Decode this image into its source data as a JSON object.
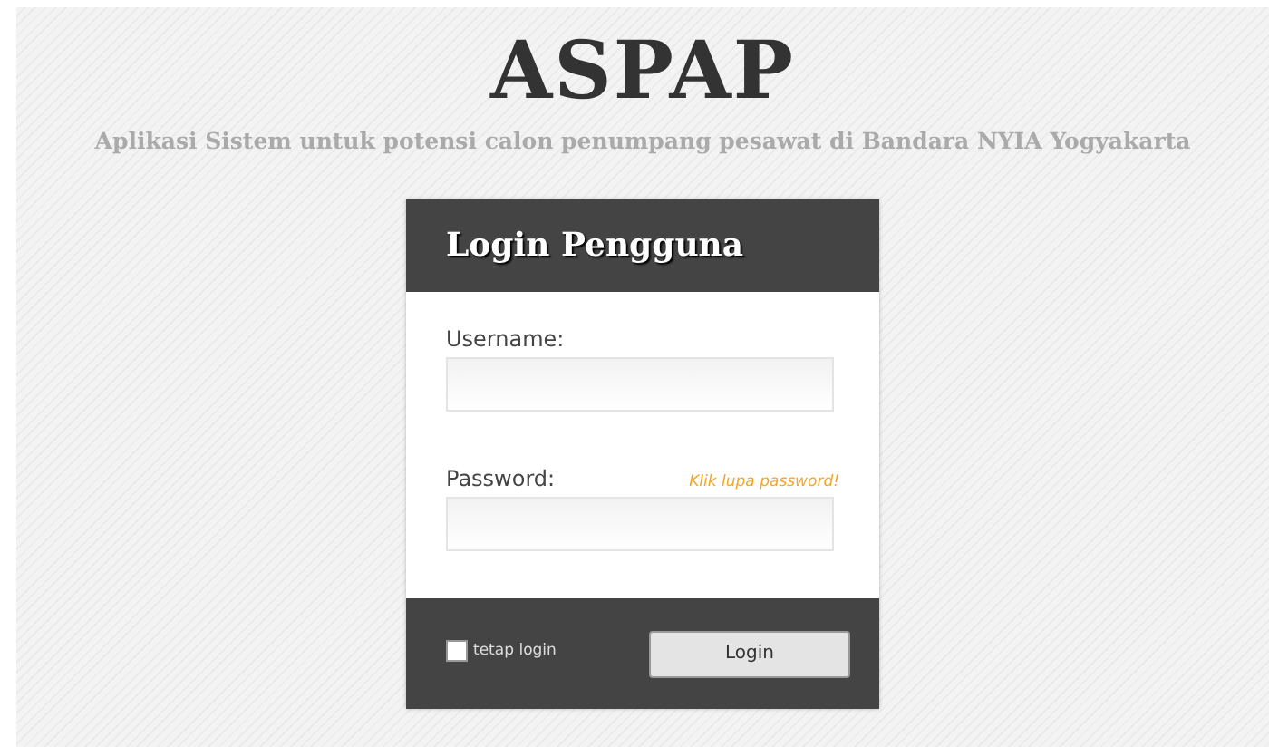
{
  "header": {
    "title": "ASPAP",
    "subtitle": "Aplikasi Sistem untuk potensi calon penumpang pesawat di Bandara NYIA Yogyakarta"
  },
  "login": {
    "title": "Login Pengguna",
    "fields": [
      {
        "label": "Username:"
      },
      {
        "label": "Password:",
        "link": "Klik lupa password!"
      }
    ],
    "remember": {
      "label": "tetap login",
      "checked": false
    },
    "button": "Login"
  }
}
